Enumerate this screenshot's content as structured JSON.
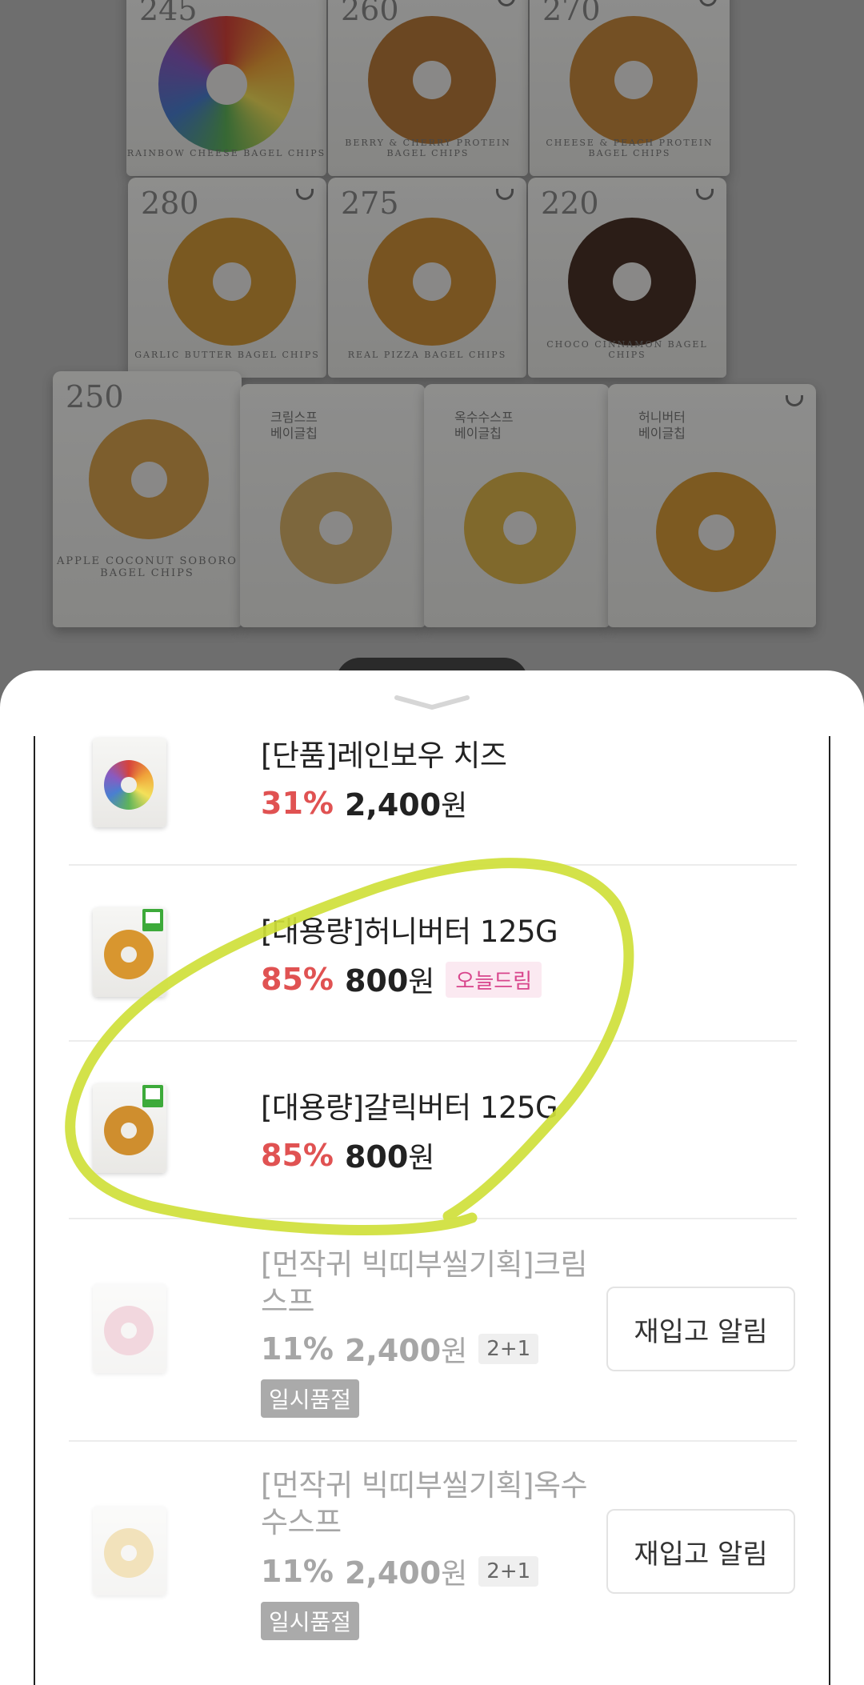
{
  "background": {
    "products": [
      {
        "kcal": "245",
        "label": "RAINBOW CHEESE BAGEL CHIPS",
        "ring": "#c0793a"
      },
      {
        "kcal": "260",
        "label": "BERRY & CHERRY PROTEIN BAGEL CHIPS",
        "ring": "#b87b3c"
      },
      {
        "kcal": "270",
        "label": "CHEESE & PEACH PROTEIN BAGEL CHIPS",
        "ring": "#c98b3e"
      },
      {
        "kcal": "280",
        "label": "GARLIC BUTTER BAGEL CHIPS",
        "ring": "#d39a3a"
      },
      {
        "kcal": "275",
        "label": "REAL PIZZA BAGEL CHIPS",
        "ring": "#cf923a"
      },
      {
        "kcal": "220",
        "label": "CHOCO CINNAMON BAGEL CHIPS",
        "ring": "#4a3328"
      },
      {
        "kcal": "250",
        "label": "APPLE COCONUT SOBORO BAGEL CHIPS",
        "ring": "#d8a24e"
      },
      {
        "kor": "크림스프\n베이글칩",
        "label": "",
        "ring": "#d7b26a"
      },
      {
        "kor": "옥수수스프\n베이글칩",
        "label": "",
        "ring": "#dcb54d"
      },
      {
        "kor": "허니버터\n베이글칩",
        "label": "",
        "ring": "#d89c3a"
      }
    ]
  },
  "items": [
    {
      "name": "[단품]레인보우 치즈",
      "discount": "31%",
      "price": "2,400",
      "currency": "원",
      "ring": "#9a6b3a"
    },
    {
      "name": "[대용량]허니버터 125G",
      "discount": "85%",
      "price": "800",
      "currency": "원",
      "badge": "오늘드림",
      "ring": "#d8962f"
    },
    {
      "name": "[대용량]갈릭버터 125G",
      "discount": "85%",
      "price": "800",
      "currency": "원",
      "ring": "#cf8e2e"
    },
    {
      "name": "[먼작귀 빅띠부씰기획]크림스프",
      "discount": "11%",
      "price": "2,400",
      "currency": "원",
      "badge": "2+1",
      "status": "일시품절",
      "action": "재입고 알림",
      "ring": "#e3a8b8"
    },
    {
      "name": "[먼작귀 빅띠부씰기획]옥수수스프",
      "discount": "11%",
      "price": "2,400",
      "currency": "원",
      "badge": "2+1",
      "status": "일시품절",
      "action": "재입고 알림",
      "ring": "#e4c06a"
    }
  ],
  "colors": {
    "highlighter": "#cfe03a",
    "discount": "#e05252"
  }
}
